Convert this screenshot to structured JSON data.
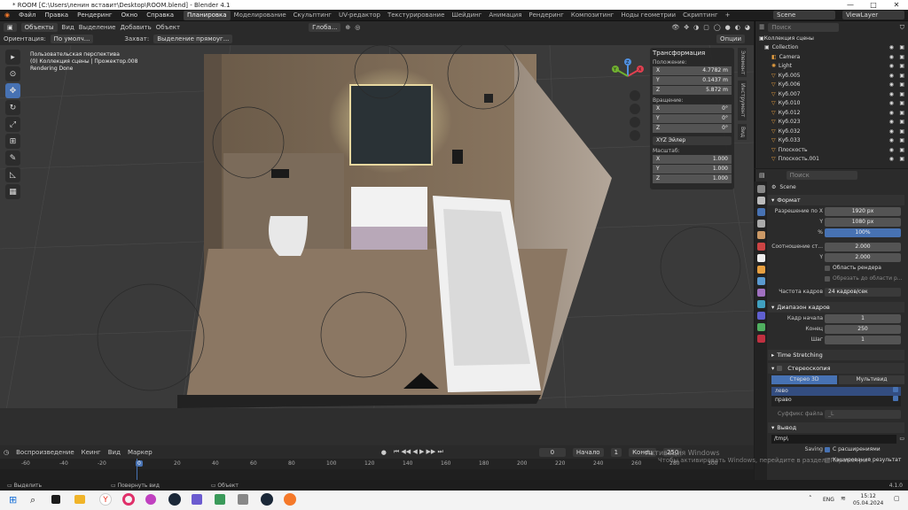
{
  "window": {
    "title": "* ROOM [C:\\Users\\ленин вставит\\Desktop\\ROOM.blend] - Blender 4.1",
    "min": "—",
    "max": "□",
    "close": "✕"
  },
  "menu": {
    "items": [
      "Файл",
      "Правка",
      "Рендеринг",
      "Окно",
      "Справка"
    ],
    "workspaces": [
      "Планировка",
      "Моделирование",
      "Скульптинг",
      "UV-редактор",
      "Текстурирование",
      "Шейдинг",
      "Анимация",
      "Рендеринг",
      "Композитинг",
      "Ноды геометрии",
      "Скриптинг"
    ],
    "active_workspace": "Планировка",
    "scene": "Scene",
    "view_layer": "ViewLayer"
  },
  "header": {
    "mode": "Объекты",
    "view": "Вид",
    "select": "Выделение",
    "add": "Добавить",
    "object": "Объект",
    "transform": "Глоба...",
    "options": "Опции"
  },
  "header2": {
    "orientation_label": "Ориентация:",
    "orientation": "По умолч...",
    "capture_label": "Захват:",
    "capture": "Выделение прямоуг..."
  },
  "viewport": {
    "line1": "Пользовательская перспектива",
    "line2": "(0) Коллекция сцены | Прожектор.008",
    "line3": "Rendering Done"
  },
  "npanel": {
    "title": "Трансформация",
    "location": "Положение:",
    "loc": [
      {
        "axis": "X",
        "val": "4.7782 m"
      },
      {
        "axis": "Y",
        "val": "0.1437 m"
      },
      {
        "axis": "Z",
        "val": "5.872 m"
      }
    ],
    "rotation": "Вращение:",
    "rot": [
      {
        "axis": "X",
        "val": "0°"
      },
      {
        "axis": "Y",
        "val": "0°"
      },
      {
        "axis": "Z",
        "val": "0°"
      }
    ],
    "euler": "XYZ Эйлер",
    "scale": "Масштаб:",
    "scl": [
      {
        "axis": "X",
        "val": "1.000"
      },
      {
        "axis": "Y",
        "val": "1.000"
      },
      {
        "axis": "Z",
        "val": "1.000"
      }
    ],
    "tabs": [
      "Элемент",
      "Инструмент",
      "Вид"
    ]
  },
  "gizmo": {
    "x": "X",
    "y": "Y",
    "z": "Z"
  },
  "outliner": {
    "search": "Поиск",
    "root": "Коллекция сцены",
    "items": [
      {
        "name": "Collection"
      },
      {
        "name": "Camera"
      },
      {
        "name": "Light"
      },
      {
        "name": "Куб.005"
      },
      {
        "name": "Куб.006"
      },
      {
        "name": "Куб.007"
      },
      {
        "name": "Куб.010"
      },
      {
        "name": "Куб.012"
      },
      {
        "name": "Куб.023"
      },
      {
        "name": "Куб.032"
      },
      {
        "name": "Куб.033"
      },
      {
        "name": "Плоскость"
      },
      {
        "name": "Плоскость.001"
      }
    ]
  },
  "props": {
    "search": "Поиск",
    "scene": "Scene",
    "format": "Формат",
    "res_x_label": "Разрешение по X",
    "res_x": "1920 px",
    "res_y_label": "Y",
    "res_y": "1080 px",
    "res_pct_label": "%",
    "res_pct": "100%",
    "aspect_label": "Соотношение ст...",
    "aspect_x": "2.000",
    "aspect_y_label": "Y",
    "aspect_y": "2.000",
    "render_region": "Область рендера",
    "crop": "Обрезать до области р...",
    "fps_label": "Частота кадров",
    "fps": "24 кадров/сек",
    "frame_range": "Диапазон кадров",
    "start_label": "Кадр начала",
    "start": "1",
    "end_label": "Конец",
    "end": "250",
    "step_label": "Шаг",
    "step": "1",
    "time_stretching": "Time Stretching",
    "stereo": "Стереоскопия",
    "stereo3d": "Стерео 3D",
    "multiview": "Мультивид",
    "left": "лево",
    "right": "право",
    "suffix_label": "Суффикс файла",
    "suffix": "_L",
    "output": "Вывод",
    "path": "/tmp\\",
    "saving": "Saving",
    "extensions": "С расширениями",
    "cache": "Кэширование результат"
  },
  "timeline": {
    "playback": "Воспроизведение",
    "keying": "Кеинг",
    "view": "Вид",
    "marker": "Маркер",
    "current": "0",
    "start_label": "Начало",
    "start": "1",
    "end_label": "Конец",
    "end": "250",
    "ticks": [
      "-60",
      "-40",
      "-20",
      "0",
      "20",
      "40",
      "60",
      "80",
      "100",
      "120",
      "140",
      "160",
      "180",
      "200",
      "220",
      "240",
      "260",
      "280",
      "300"
    ]
  },
  "watermark": {
    "line1": "Активация Windows",
    "line2": "Чтобы активировать Windows, перейдите в раздел \"Параметры\"."
  },
  "status": {
    "select": "Выделить",
    "rotate": "Повернуть вид",
    "object": "Объект",
    "version": "4.1.0"
  },
  "taskbar": {
    "lang": "ENG",
    "time": "15:12",
    "date": "05.04.2024"
  }
}
